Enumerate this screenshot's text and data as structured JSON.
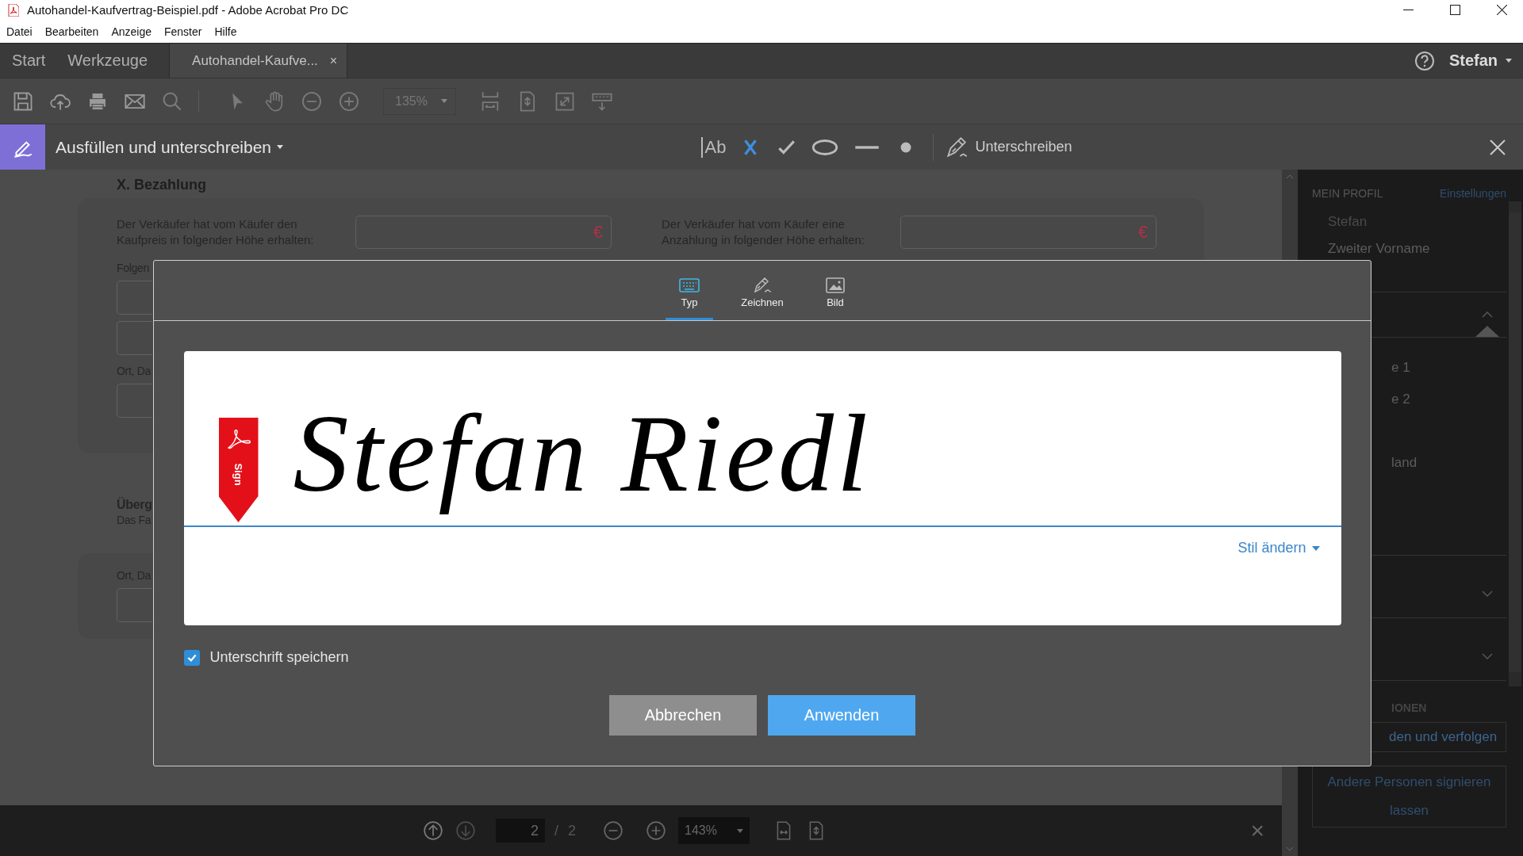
{
  "window": {
    "title": "Autohandel-Kaufvertrag-Beispiel.pdf - Adobe Acrobat Pro DC"
  },
  "menu": [
    "Datei",
    "Bearbeiten",
    "Anzeige",
    "Fenster",
    "Hilfe"
  ],
  "tabs": [
    {
      "label": "Start",
      "selected": false
    },
    {
      "label": "Werkzeuge",
      "selected": false
    },
    {
      "label": "Autohandel-Kaufve...",
      "selected": true,
      "close": "×"
    }
  ],
  "user": "Stefan",
  "toolbar": {
    "zoom": "135%"
  },
  "fill_sign": {
    "title": "Ausfüllen und unterschreiben",
    "text_tool": "Ab",
    "sign_label": "Unterschreiben"
  },
  "document": {
    "heading": "X. Bezahlung",
    "fields": [
      {
        "label": "Der Verkäufer hat vom Käufer den\nKaufpreis in folgender Höhe erhalten:",
        "unit": "€"
      },
      {
        "label": "Der Verkäufer hat vom Käufer eine\nAnzahlung in folgender Höhe erhalten:",
        "unit": "€"
      }
    ],
    "fragment_1": "Folgen",
    "fragment_2": "Ort, Da",
    "heading_2": "Überg",
    "fragment_3": "Das Fa",
    "fragment_4": "Ort, Da"
  },
  "dialog": {
    "tabs": [
      {
        "label": "Typ",
        "selected": true
      },
      {
        "label": "Zeichnen",
        "selected": false
      },
      {
        "label": "Bild",
        "selected": false
      }
    ],
    "badge": "Sign",
    "signature": "Stefan Riedl",
    "style_link": "Stil ändern",
    "save": {
      "label": "Unterschrift speichern",
      "checked": true
    },
    "buttons": [
      {
        "label": "Abbrechen",
        "kind": "secondary"
      },
      {
        "label": "Anwenden",
        "kind": "primary"
      }
    ]
  },
  "side_panel": {
    "title": "MEIN PROFIL",
    "settings": "Einstellungen",
    "fields": [
      "Stefan",
      "Zweiter Vorname"
    ],
    "partial_fields": [
      "e 1",
      "e 2",
      "land"
    ],
    "section": "IONEN",
    "buttons": [
      "den und verfolgen",
      "Andere Personen signieren\nlassen"
    ]
  },
  "bottom_bar": {
    "page": "2",
    "separator": "/",
    "total": "2",
    "zoom": "143%",
    "close": "×"
  }
}
